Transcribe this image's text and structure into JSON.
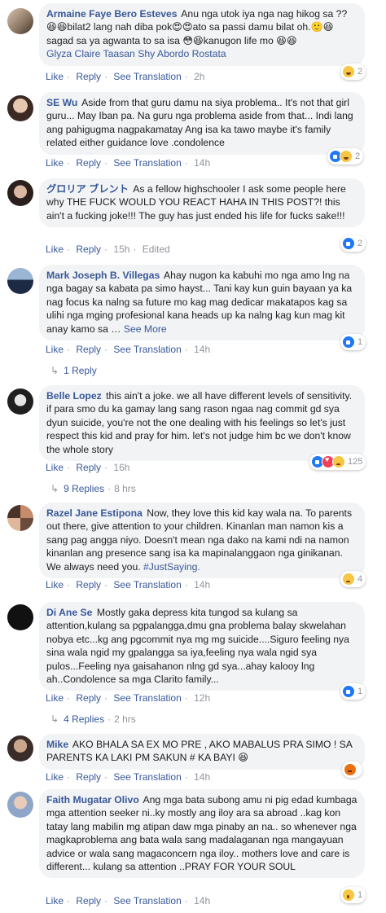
{
  "colors": {
    "link": "#385898",
    "bubble": "#f2f3f5",
    "meta": "#90949c",
    "text": "#1c1e21"
  },
  "actions": {
    "like": "Like",
    "reply": "Reply",
    "see_translation": "See Translation",
    "edited": "Edited"
  },
  "comments": [
    {
      "author": "Armaine Faye Bero Esteves",
      "text": "Anu nga utok iya nga nag hikog sa ?? 😆😆bilat2 lang nah diba pok😍😍ato sa passi damu bilat oh.🙂😆sagad sa ya agwanta to sa isa 😳😆kanugon life mo 😆😆",
      "tagged": "Glyza Claire Taasan Shy Abordo Rostata",
      "time": "2h",
      "reaction_count": "2",
      "reaction_types": [
        "haha-icon"
      ]
    },
    {
      "author": "SE Wu",
      "text": "Aside from that guru damu na siya problema.. It's not that girl guru... May Iban pa. Na guru nga problema aside from that... Indi lang ang pahigugma nagpakamatay Ang isa ka tawo maybe it's family related either guidance love .condolence",
      "time": "14h",
      "reaction_count": "2",
      "reaction_types": [
        "like-icon",
        "haha-icon"
      ]
    },
    {
      "author": "グロリア ブレント",
      "text": "As a fellow highschooler I ask some people here why THE FUCK WOULD YOU REACT HAHA IN THIS POST?! this ain't a fucking joke!!! The guy has just ended his life for fucks sake!!!",
      "time": "15h",
      "reaction_count": "2",
      "reaction_types": [
        "like-icon"
      ]
    },
    {
      "author": "Mark Joseph B. Villegas",
      "text": "Ahay nugon ka kabuhi mo nga amo lng na nga bagay sa kabata pa simo hayst... Tani kay kun guin bayaan ya ka nag focus ka nalng sa future mo kag mag dedicar makatapos kag sa ulihi nga mging profesional kana heads up ka nalng kag kun mag kit anay kamo sa …",
      "see_more": "See More",
      "time": "14h",
      "reaction_count": "1",
      "reaction_types": [
        "like-icon"
      ],
      "replies_label": "1 Reply",
      "replies_time": ""
    },
    {
      "author": "Belle Lopez",
      "text": "this ain't a joke. we all have different levels of sensitivity. if para smo du ka gamay lang sang rason ngaa nag commit gd sya dyun suicide, you're not the one dealing with his feelings so let's just respect this kid and pray for him. let's not judge him bc we don't know the whole story",
      "time": "16h",
      "reaction_count": "125",
      "reaction_types": [
        "like-icon",
        "love-icon",
        "sad-icon"
      ],
      "replies_label": "9 Replies",
      "replies_time": "8 hrs"
    },
    {
      "author": "Razel Jane Estipona",
      "text": "Now, they love this kid kay wala na. To parents out there, give attention to your children. Kinanlan man namon kis a sang pag angga niyo. Doesn't mean nga dako na kami ndi na namon kinanlan ang presence sang isa ka mapinalanggaon nga ginikanan. We always need you.",
      "hashtag": "#JustSaying.",
      "time": "14h",
      "reaction_count": "4",
      "reaction_types": [
        "sad-icon"
      ]
    },
    {
      "author": "Di Ane Se",
      "text": "Mostly gaka depress kita tungod sa kulang sa attention,kulang sa pgpalangga,dmu gna problema balay skwelahan nobya etc...kg ang pgcommit nya mg mg suicide....Siguro feeling nya sina wala ngid my gpalangga sa iya,feeling nya wala ngid sya pulos...Feeling nya gaisahanon nlng gd sya...ahay kalooy lng ah..Condolence sa mga Clarito family...",
      "time": "12h",
      "reaction_count": "1",
      "reaction_types": [
        "like-icon"
      ],
      "replies_label": "4 Replies",
      "replies_time": "2 hrs"
    },
    {
      "author": "Mike",
      "text": "AKO BHALA SA EX MO PRE , AKO MABALUS PRA SIMO ! SA PARENTS KA LAKI PM SAKUN # KA BAYI 😆",
      "time": "14h",
      "reaction_count": "",
      "reaction_types": [
        "angry-icon"
      ]
    },
    {
      "author": "Faith Mugatar Olivo",
      "text": "Ang mga bata subong amu ni pig edad kumbaga mga attention seeker ni..ky mostly ang iloy ara sa abroad ..kag kon tatay lang mabilin mg atipan daw mga pinaby an na.. so whenever nga magkaproblema ang bata wala sang madalaganan nga mangayuan advice or wala sang magaconcern nga iloy.. mothers love and care is different... kulang sa attention ..PRAY FOR YOUR SOUL",
      "time": "14h",
      "reaction_count": "1",
      "reaction_types": [
        "wow-icon"
      ]
    }
  ]
}
